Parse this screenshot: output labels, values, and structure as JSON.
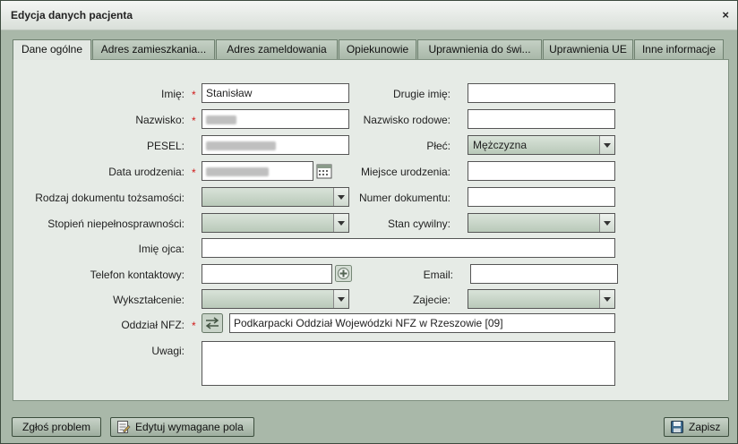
{
  "dialog": {
    "title": "Edycja danych pacjenta",
    "close_label": "×"
  },
  "tabs": [
    {
      "label": "Dane ogólne"
    },
    {
      "label": "Adres zamieszkania..."
    },
    {
      "label": "Adres zameldowania"
    },
    {
      "label": "Opiekunowie"
    },
    {
      "label": "Uprawnienia do świ..."
    },
    {
      "label": "Uprawnienia UE"
    },
    {
      "label": "Inne informacje"
    }
  ],
  "form": {
    "imie": {
      "label": "Imię:",
      "value": "Stanisław"
    },
    "drugie_imie": {
      "label": "Drugie imię:",
      "value": ""
    },
    "nazwisko": {
      "label": "Nazwisko:"
    },
    "nazwisko_rodowe": {
      "label": "Nazwisko rodowe:",
      "value": ""
    },
    "pesel": {
      "label": "PESEL:"
    },
    "plec": {
      "label": "Płeć:",
      "value": "Mężczyzna"
    },
    "data_urodzenia": {
      "label": "Data urodzenia:"
    },
    "miejsce_urodzenia": {
      "label": "Miejsce urodzenia:",
      "value": ""
    },
    "rodzaj_dokumentu": {
      "label": "Rodzaj dokumentu tożsamości:",
      "value": ""
    },
    "numer_dokumentu": {
      "label": "Numer dokumentu:",
      "value": ""
    },
    "stopien_niepelnosprawnosci": {
      "label": "Stopień niepełnosprawności:",
      "value": ""
    },
    "stan_cywilny": {
      "label": "Stan cywilny:",
      "value": ""
    },
    "imie_ojca": {
      "label": "Imię ojca:",
      "value": ""
    },
    "telefon": {
      "label": "Telefon kontaktowy:",
      "value": ""
    },
    "email": {
      "label": "Email:",
      "value": ""
    },
    "wyksztalcenie": {
      "label": "Wykształcenie:",
      "value": ""
    },
    "zajecie": {
      "label": "Zajecie:",
      "value": ""
    },
    "oddzial_nfz": {
      "label": "Oddział NFZ:",
      "value": "Podkarpacki Oddział Wojewódzki NFZ w Rzeszowie [09]"
    },
    "uwagi": {
      "label": "Uwagi:",
      "value": ""
    },
    "required_mark": "*"
  },
  "footer": {
    "report_label": "Zgłoś problem",
    "edit_required_label": "Edytuj wymagane pola",
    "save_label": "Zapisz"
  },
  "colors": {
    "required": "#d01a1a",
    "accent": "#a9b8a9"
  }
}
